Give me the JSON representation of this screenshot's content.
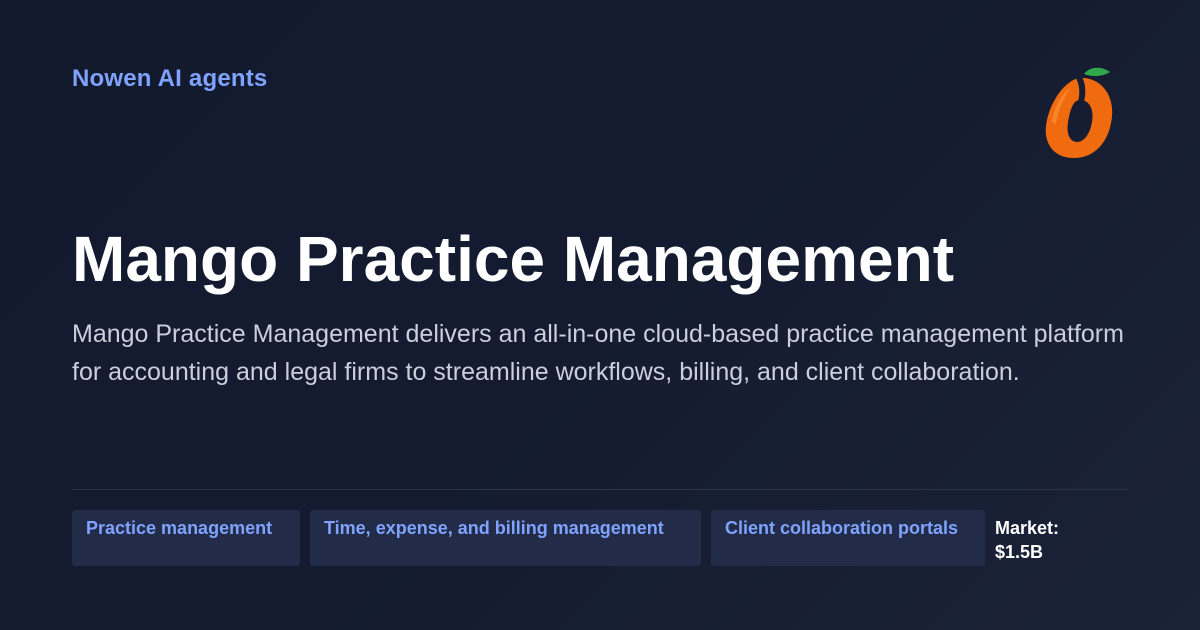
{
  "brand": {
    "label": "Nowen AI agents",
    "color": "#7fa3ff"
  },
  "logo": {
    "icon": "mango-logo-icon",
    "colors": {
      "fruit": "#f06b0f",
      "leaf": "#2ea84a"
    }
  },
  "hero": {
    "title": "Mango Practice Management",
    "description": "Mango Practice Management delivers an all-in-one cloud-based practice management platform for accounting and legal firms to streamline workflows, billing, and client collaboration."
  },
  "tags": [
    {
      "label": "Practice management"
    },
    {
      "label": "Time, expense, and billing management"
    },
    {
      "label": "Client collaboration portals"
    }
  ],
  "market": {
    "label": "Market:",
    "value": "$1.5B"
  },
  "colors": {
    "background": "#141b30",
    "tag_background": "#222c48",
    "accent": "#7fa3ff"
  }
}
